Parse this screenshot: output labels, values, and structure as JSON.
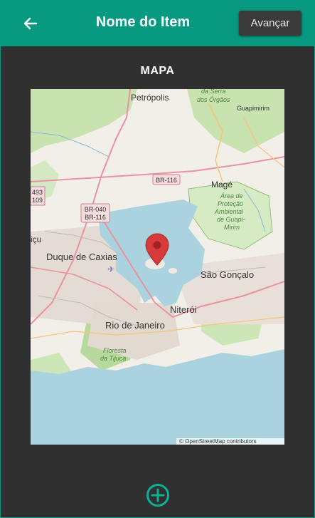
{
  "appbar": {
    "title": "Nome do Item",
    "next_label": "Avançar",
    "color": "#079a80"
  },
  "section": {
    "label": "MAPA"
  },
  "map": {
    "places": {
      "petropolis": "Petrópolis",
      "serra": "da Serra",
      "orgaos": "dos Órgãos",
      "guapimirim": "Guapimirim",
      "mage": "Magé",
      "area": "Área de",
      "protecao": "Proteção",
      "ambiental": "Ambiental",
      "guapi": "de Guapi-",
      "mirim": "Mirim",
      "duque": "Duque de Caxias",
      "caxias_partial": "içu",
      "sao_goncalo": "São Gonçalo",
      "niteroi": "Niterói",
      "rio": "Rio de Janeiro",
      "floresta": "Floresta",
      "tijuca": "da Tijuca"
    },
    "roads": {
      "br116": "BR-116",
      "br040": "BR-040",
      "br116b": "BR-116",
      "r493": "493",
      "r109": "109"
    },
    "attribution": "© OpenStreetMap contributors",
    "marker_color": "#d63a3a"
  },
  "icons": {
    "back": "arrow-left-icon",
    "add": "plus-circle-icon",
    "marker": "map-marker-icon"
  }
}
